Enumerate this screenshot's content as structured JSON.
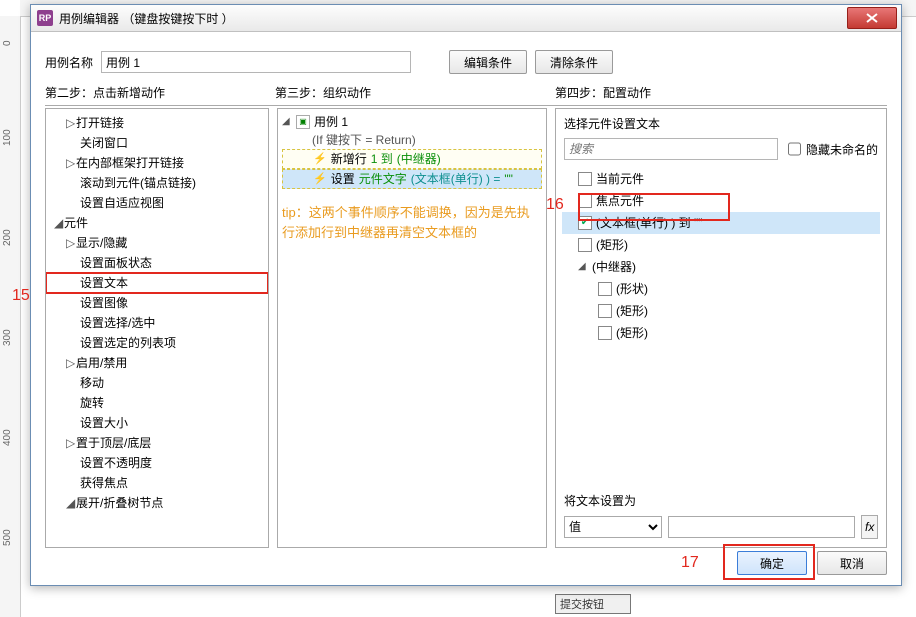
{
  "window": {
    "app_icon_text": "RP",
    "title": "用例编辑器 （键盘按键按下时 ）"
  },
  "top_row": {
    "name_label": "用例名称",
    "name_value": "用例 1",
    "edit_cond": "编辑条件",
    "clear_cond": "清除条件"
  },
  "steps": {
    "s2": "第二步：点击新增动作",
    "s3": "第三步：组织动作",
    "s4": "第四步：配置动作"
  },
  "panel1": {
    "grp0_collapse": "▸",
    "items_top": [
      "打开链接",
      "关闭窗口",
      "在内部框架打开链接",
      "滚动到元件(锚点链接)",
      "设置自适应视图"
    ],
    "grp_yj": "元件",
    "items_yj": [
      "显示/隐藏",
      "设置面板状态",
      "设置文本",
      "设置图像",
      "设置选择/选中",
      "设置选定的列表项",
      "启用/禁用",
      "移动",
      "旋转",
      "设置大小",
      "置于顶层/底层",
      "设置不透明度",
      "获得焦点",
      "展开/折叠树节点"
    ],
    "toggle_open": "◢",
    "toggle_closed": "▷"
  },
  "panel2": {
    "case_label": "用例 1",
    "cond_text": "(If 键按下 = Return)",
    "act1_pre": "新增行",
    "act1_mid": "1 到",
    "act1_suf": "(中继器)",
    "act2_pre": "设置",
    "act2_g1": "元件文字",
    "act2_t1": "(文本框(单行) ) =",
    "act2_end": "\"\"",
    "tip": "tip：这两个事件顺序不能调换，因为是先执行添加行到中继器再清空文本框的"
  },
  "panel3": {
    "select_label": "选择元件设置文本",
    "search_placeholder": "搜索",
    "hide_unnamed": "隐藏未命名的",
    "items": {
      "current": "当前元件",
      "focus": "焦点元件",
      "textbox": "(文本框(单行) ) 到",
      "textbox_suffix": "\"\"",
      "rect0": "(矩形)",
      "repeater": "(中继器)",
      "shape": "(形状)",
      "rect1": "(矩形)",
      "rect2": "(矩形)"
    },
    "set_to_label": "将文本设置为",
    "set_to_option": "值",
    "fx": "fx"
  },
  "buttons": {
    "ok": "确定",
    "cancel": "取消"
  },
  "annotations": {
    "n15": "15",
    "n16": "16",
    "n17": "17"
  },
  "background": {
    "submit_btn": "提交按钮",
    "ruler_marks": [
      "0",
      "100",
      "200",
      "300",
      "400",
      "500"
    ]
  }
}
